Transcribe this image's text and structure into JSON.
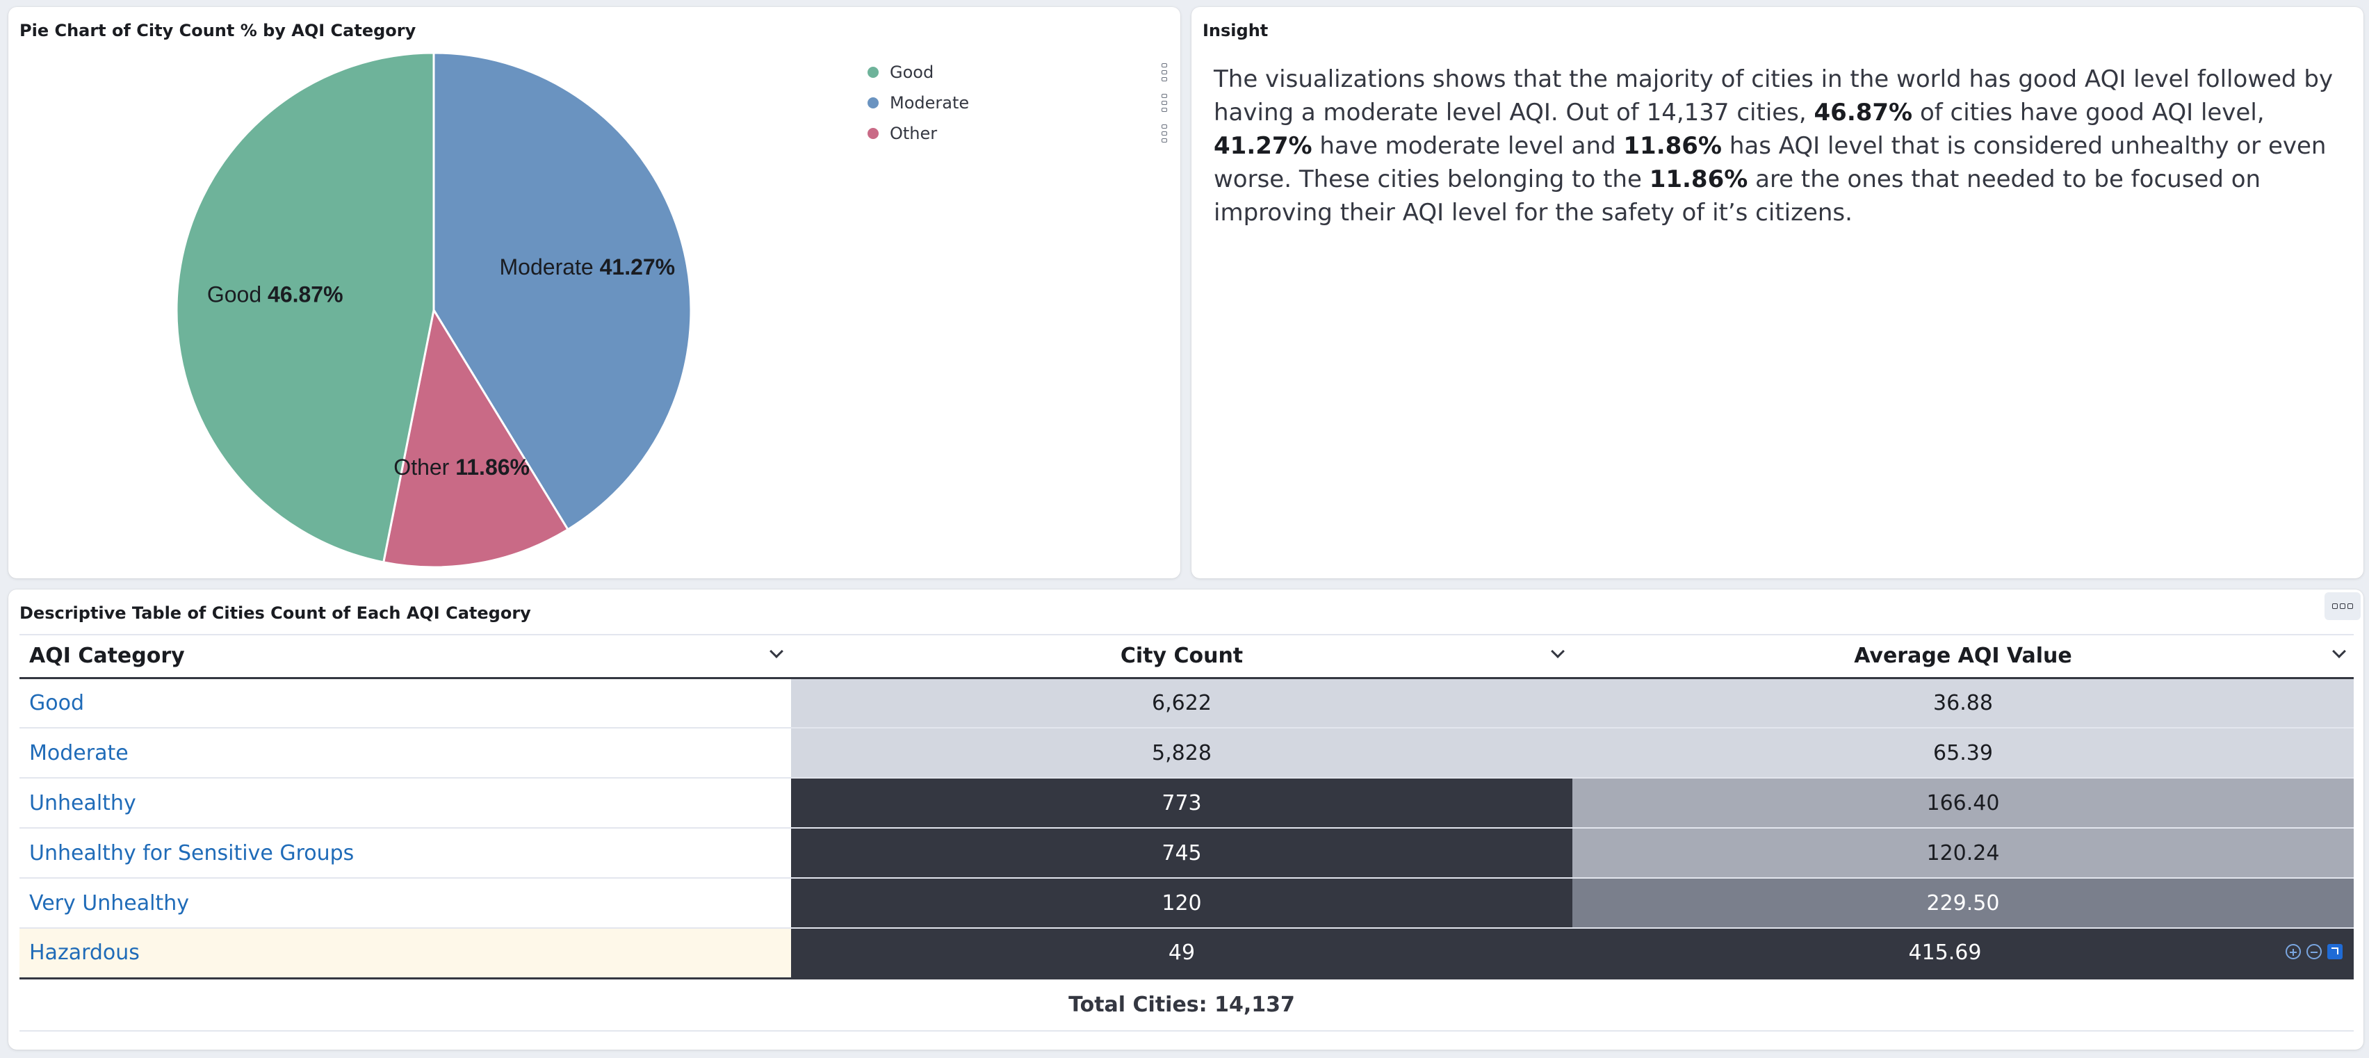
{
  "pie_panel": {
    "title": "Pie Chart of City Count % by AQI Category",
    "legend": [
      {
        "label": "Good",
        "color": "#6eb39a"
      },
      {
        "label": "Moderate",
        "color": "#6a93c0"
      },
      {
        "label": "Other",
        "color": "#c96a86"
      }
    ]
  },
  "chart_data": {
    "type": "pie",
    "title": "Pie Chart of City Count % by AQI Category",
    "slices": [
      {
        "label": "Moderate",
        "value": 41.27,
        "display": "41.27%",
        "color": "#6a93c0"
      },
      {
        "label": "Other",
        "value": 11.86,
        "display": "11.86%",
        "color": "#c96a86"
      },
      {
        "label": "Good",
        "value": 46.87,
        "display": "46.87%",
        "color": "#6eb39a"
      }
    ],
    "legend_position": "top-right"
  },
  "insight_panel": {
    "title": "Insight",
    "segments": [
      {
        "text": "The visualizations shows that the majority of cities in the world has good AQI level followed by having a moderate level AQI. Out of 14,137 cities, ",
        "bold": false
      },
      {
        "text": "46.87%",
        "bold": true
      },
      {
        "text": " of cities have good AQI level, ",
        "bold": false
      },
      {
        "text": "41.27%",
        "bold": true
      },
      {
        "text": " have moderate level and ",
        "bold": false
      },
      {
        "text": "11.86%",
        "bold": true
      },
      {
        "text": " has AQI level that is considered unhealthy or even worse. These cities belonging to the ",
        "bold": false
      },
      {
        "text": "11.86%",
        "bold": true
      },
      {
        "text": " are the ones that needed to be focused on improving their AQI level for the safety of it’s citizens.",
        "bold": false
      }
    ]
  },
  "table_panel": {
    "title": "Descriptive Table of Cities Count of Each AQI Category",
    "columns": [
      "AQI Category",
      "City Count",
      "Average AQI Value"
    ],
    "rows": [
      {
        "category": "Good",
        "count": "6,622",
        "avg": "36.88",
        "count_bg": "#d3d7e0",
        "count_fg": "#1a1c21",
        "avg_bg": "#d3d7e0",
        "avg_fg": "#1a1c21"
      },
      {
        "category": "Moderate",
        "count": "5,828",
        "avg": "65.39",
        "count_bg": "#d3d7e0",
        "count_fg": "#1a1c21",
        "avg_bg": "#d3d7e0",
        "avg_fg": "#1a1c21"
      },
      {
        "category": "Unhealthy",
        "count": "773",
        "avg": "166.40",
        "count_bg": "#343741",
        "count_fg": "#ffffff",
        "avg_bg": "#a7abb6",
        "avg_fg": "#1a1c21"
      },
      {
        "category": "Unhealthy for Sensitive Groups",
        "count": "745",
        "avg": "120.24",
        "count_bg": "#343741",
        "count_fg": "#ffffff",
        "avg_bg": "#a7abb6",
        "avg_fg": "#1a1c21"
      },
      {
        "category": "Very Unhealthy",
        "count": "120",
        "avg": "229.50",
        "count_bg": "#343741",
        "count_fg": "#ffffff",
        "avg_bg": "#7a7f8c",
        "avg_fg": "#ffffff"
      },
      {
        "category": "Hazardous",
        "count": "49",
        "avg": "415.69",
        "count_bg": "#343741",
        "count_fg": "#ffffff",
        "avg_bg": "#343741",
        "avg_fg": "#ffffff"
      }
    ],
    "footer": "Total Cities: 14,137"
  }
}
